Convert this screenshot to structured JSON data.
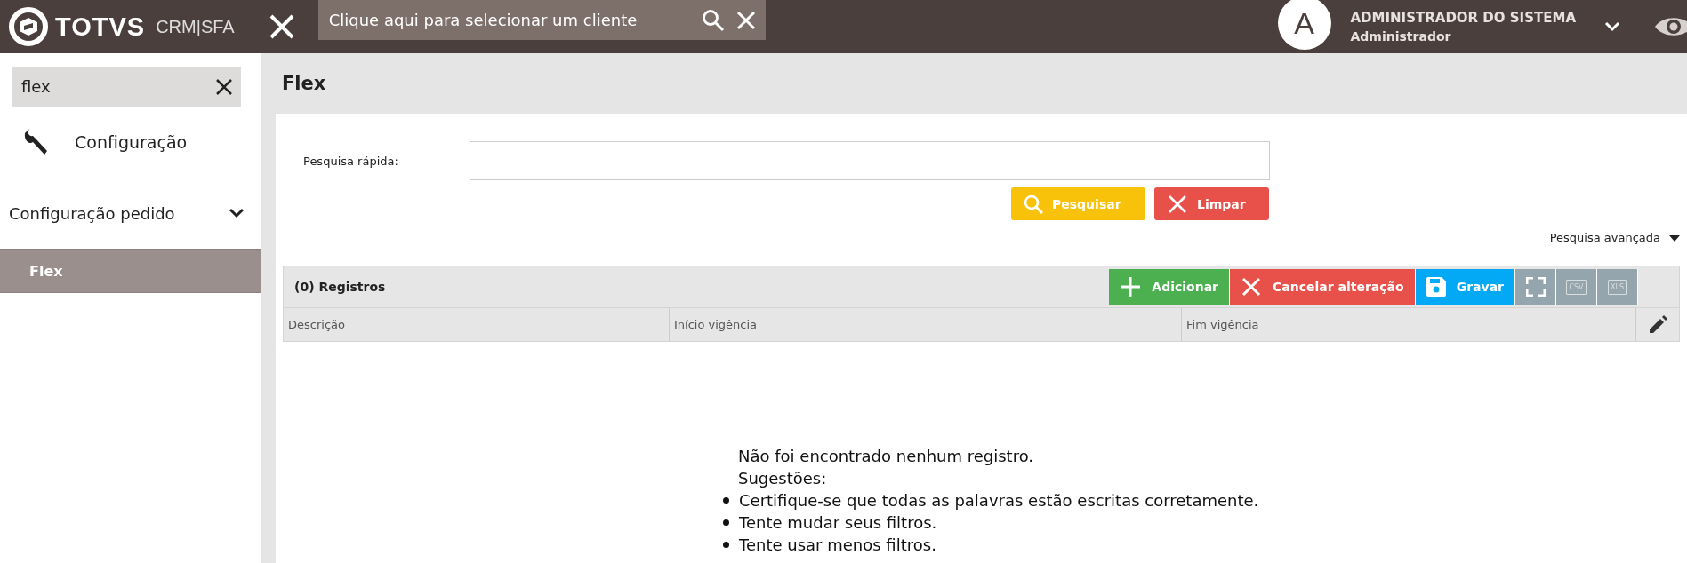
{
  "top_bar": {
    "logo": {
      "brand": "TOTVS",
      "product": "CRM|SFA"
    },
    "client_search": {
      "placeholder": "Clique aqui para selecionar um cliente"
    },
    "user": {
      "avatar_letter": "A",
      "name": "ADMINISTRADOR DO SISTEMA",
      "role": "Administrador"
    }
  },
  "sidebar": {
    "search": {
      "value": "flex"
    },
    "items": [
      {
        "kind": "section",
        "label": "Configuração",
        "selected": false
      },
      {
        "kind": "group",
        "label": "Configuração pedido",
        "expanded": true,
        "selected": false
      },
      {
        "kind": "leaf",
        "label": "Flex",
        "selected": true
      }
    ]
  },
  "page": {
    "title": "Flex",
    "quick_search": {
      "label": "Pesquisa rápida:"
    },
    "buttons": [
      {
        "kind": "search",
        "label": "Pesquisar"
      },
      {
        "kind": "clear",
        "label": "Limpar"
      }
    ],
    "advanced_search": {
      "label": "Pesquisa avançada",
      "expanded": false
    }
  },
  "table": {
    "count_label": "(0) Registros",
    "toolbar": [
      {
        "kind": "add",
        "label": "Adicionar"
      },
      {
        "kind": "cancel",
        "label": "Cancelar alteração"
      },
      {
        "kind": "save",
        "label": "Gravar"
      },
      {
        "kind": "fullscreen"
      },
      {
        "kind": "csv",
        "label": "CSV"
      },
      {
        "kind": "xls",
        "label": "XLS"
      }
    ],
    "columns": [
      "Descrição",
      "Início vigência",
      "Fim vigência"
    ],
    "empty_message": {
      "title": "Não foi encontrado nenhum registro.",
      "subtitle": "Sugestões:",
      "suggestions": [
        "Certifique-se que todas as palavras estão escritas corretamente.",
        "Tente mudar seus filtros.",
        "Tente usar menos filtros."
      ]
    }
  }
}
